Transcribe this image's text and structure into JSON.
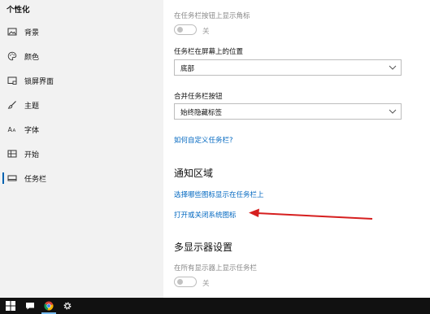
{
  "sidebar": {
    "title": "个性化",
    "items": [
      {
        "label": "背景",
        "icon": "picture-icon"
      },
      {
        "label": "颜色",
        "icon": "palette-icon"
      },
      {
        "label": "锁屏界面",
        "icon": "lock-screen-icon"
      },
      {
        "label": "主题",
        "icon": "brush-icon"
      },
      {
        "label": "字体",
        "icon": "font-icon"
      },
      {
        "label": "开始",
        "icon": "start-icon"
      },
      {
        "label": "任务栏",
        "icon": "taskbar-icon",
        "active": true
      }
    ]
  },
  "main": {
    "badges_label": "在任务栏按钮上显示角标",
    "badges_toggle": {
      "state": "关"
    },
    "position_label": "任务栏在屏幕上的位置",
    "position_value": "底部",
    "combine_label": "合并任务栏按钮",
    "combine_value": "始终隐藏标签",
    "customize_link": "如何自定义任务栏?",
    "notification_title": "通知区域",
    "select_icons_link": "选择哪些图标显示在任务栏上",
    "system_icons_link": "打开或关闭系统图标",
    "multi_display_title": "多显示器设置",
    "show_all_label": "在所有显示器上显示任务栏",
    "show_all_toggle": {
      "state": "关"
    }
  },
  "annotation": {
    "color": "#d61f1f"
  },
  "taskbar": {
    "buttons": [
      "windows-start-icon",
      "chat-icon",
      "chrome-icon",
      "settings-gear-icon"
    ]
  },
  "colors": {
    "accent": "#0063b1",
    "link": "#0067c0",
    "sidebar_bg": "#f2f2f2",
    "taskbar_bg": "#111111"
  }
}
